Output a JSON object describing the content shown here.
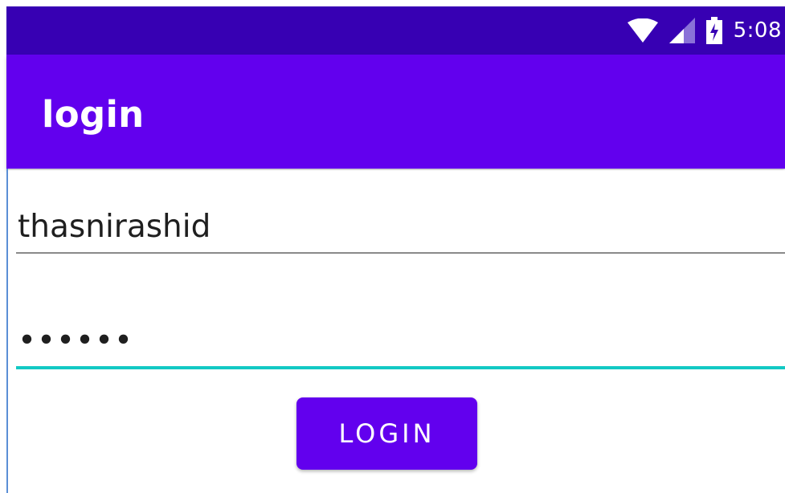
{
  "status_bar": {
    "time": "5:08",
    "icons": [
      "wifi-icon",
      "cell-signal-icon",
      "battery-charging-icon"
    ],
    "background": "#3700b3"
  },
  "app_bar": {
    "title": "login",
    "background": "#6200ee"
  },
  "form": {
    "username_value": "thasnirashid",
    "password_value": "••••••",
    "focused_field_accent": "#12c9c4",
    "login_button_label": "LOGIN",
    "button_color": "#6200ee"
  }
}
